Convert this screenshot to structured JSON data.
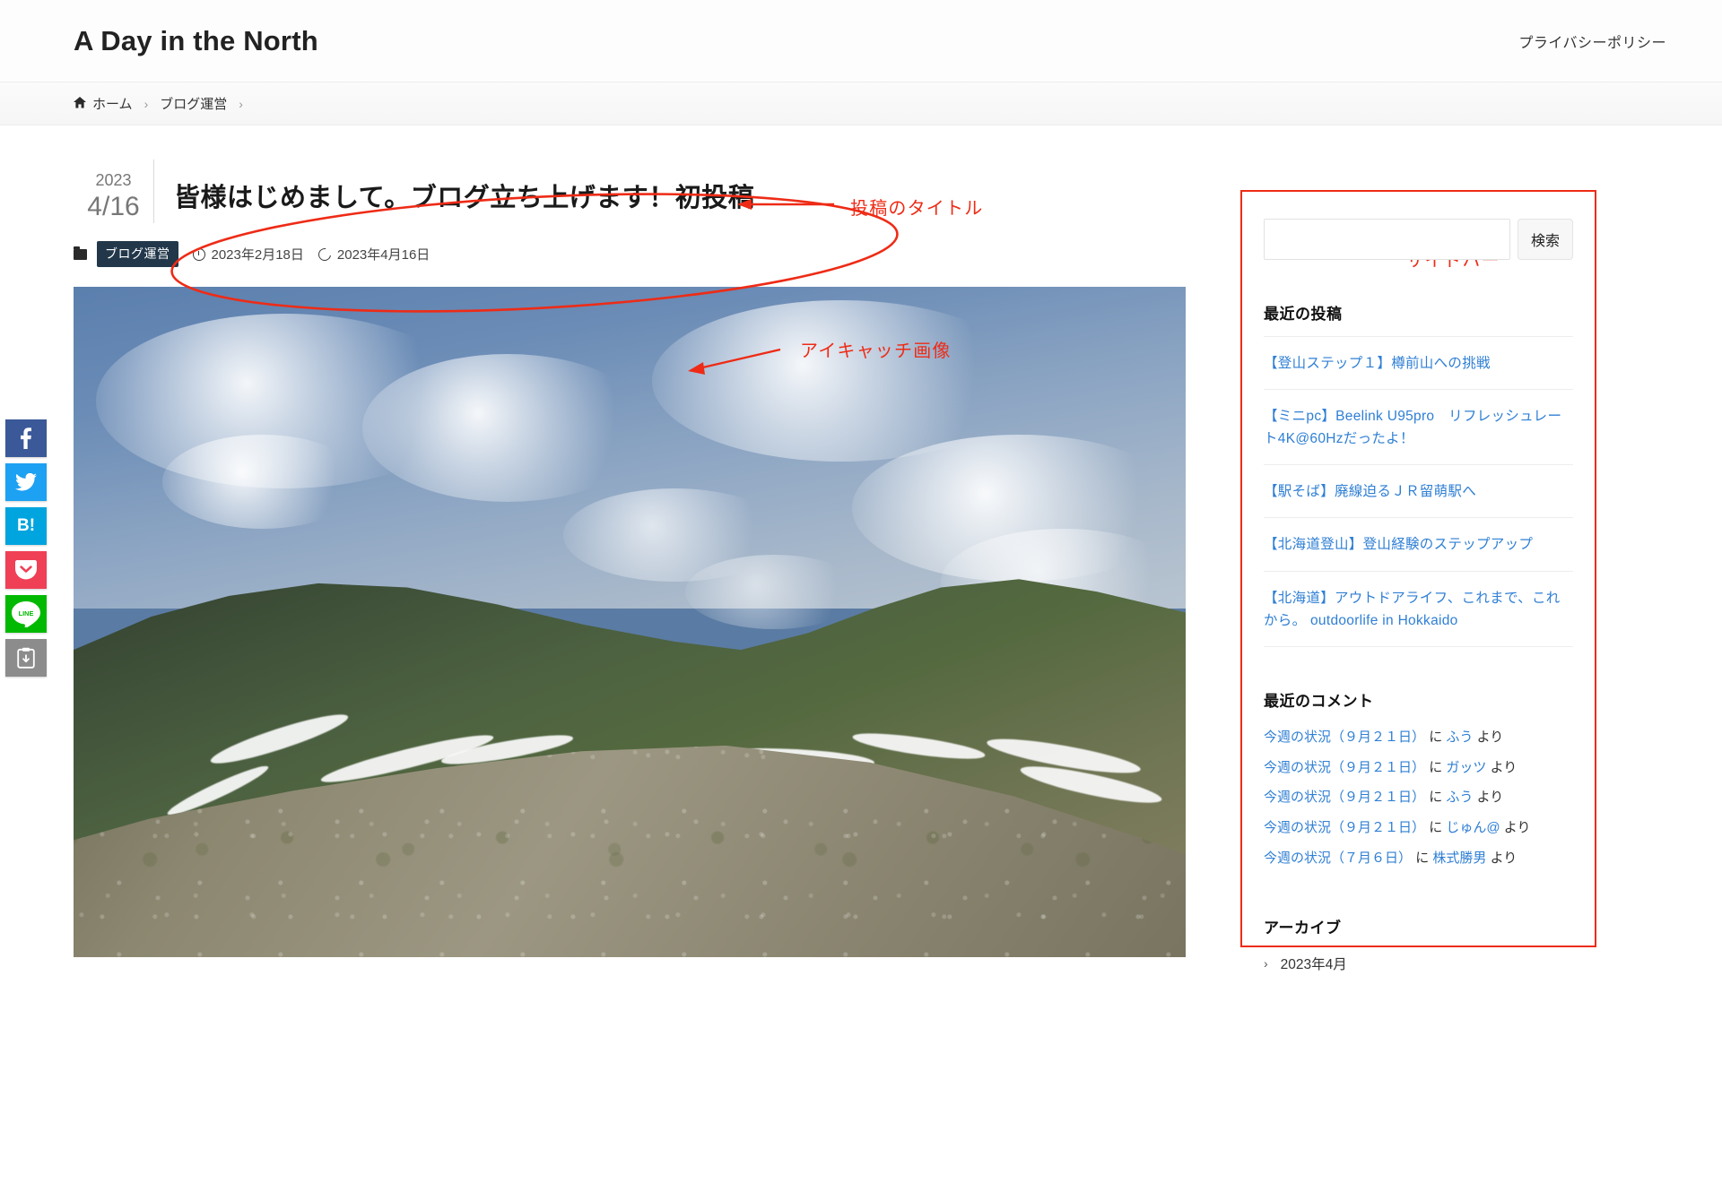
{
  "header": {
    "site_title": "A Day in the North",
    "nav": [
      {
        "label": "プライバシーポリシー",
        "name": "privacy-policy-link"
      }
    ]
  },
  "breadcrumb": {
    "home_icon": "home-icon",
    "items": [
      {
        "label": "ホーム"
      },
      {
        "label": "ブログ運営"
      }
    ],
    "separator": "›"
  },
  "post": {
    "date_year": "2023",
    "date_monthday": "4/16",
    "title": "皆様はじめまして。ブログ立ち上げます！初投稿",
    "category": "ブログ運営",
    "published_icon": "clock-icon",
    "published": "2023年2月18日",
    "updated_icon": "refresh-icon",
    "updated": "2023年4月16日",
    "eyecatch_alt": "雪渓の残る初夏の山岳風景"
  },
  "annotations": [
    {
      "id": "post-title-annotation",
      "label": "投稿のタイトル",
      "target": "post-title"
    },
    {
      "id": "eyecatch-annotation",
      "label": "アイキャッチ画像",
      "target": "eyecatch-image"
    },
    {
      "id": "sidebar-annotation",
      "label": "サイドバー",
      "target": "sidebar"
    }
  ],
  "annotation_color": "#ee2b16",
  "social_share": [
    {
      "name": "facebook-share-button",
      "glyph": "f",
      "color": "#3b5998"
    },
    {
      "name": "twitter-share-button",
      "glyph": "🐦",
      "color": "#1da1f2"
    },
    {
      "name": "hatena-bookmark-share-button",
      "glyph": "B!",
      "color": "#00a4de"
    },
    {
      "name": "pocket-share-button",
      "glyph": "▼",
      "color": "#ef4056"
    },
    {
      "name": "line-share-button",
      "glyph": "LINE",
      "color": "#00b900"
    },
    {
      "name": "copy-link-button",
      "glyph": "⎘",
      "color": "#8c8c8c"
    }
  ],
  "sidebar": {
    "search": {
      "value": "",
      "placeholder": "",
      "button_label": "検索"
    },
    "recent_posts": {
      "title": "最近の投稿",
      "items": [
        {
          "label": "【登山ステップ１】樽前山への挑戦"
        },
        {
          "label": "【ミニpc】Beelink U95pro　リフレッシュレート4K@60Hzだったよ！"
        },
        {
          "label": "【駅そば】廃線迫るＪＲ留萌駅へ"
        },
        {
          "label": "【北海道登山】登山経験のステップアップ"
        },
        {
          "label": "【北海道】アウトドアライフ、これまで、これから。 outdoorlife in Hokkaido"
        }
      ]
    },
    "recent_comments": {
      "title": "最近のコメント",
      "items": [
        {
          "post": "今週の状況（９月２１日）",
          "mid": "に",
          "author": "ふう",
          "suffix": "より"
        },
        {
          "post": "今週の状況（９月２１日）",
          "mid": "に",
          "author": "ガッツ",
          "suffix": "より"
        },
        {
          "post": "今週の状況（９月２１日）",
          "mid": "に",
          "author": "ふう",
          "suffix": "より"
        },
        {
          "post": "今週の状況（９月２１日）",
          "mid": "に",
          "author": "じゅん@",
          "suffix": "より"
        },
        {
          "post": "今週の状況（７月６日）",
          "mid": "に",
          "author": "株式勝男",
          "suffix": "より"
        }
      ]
    },
    "archives": {
      "title": "アーカイブ",
      "items": [
        {
          "label": "2023年4月",
          "chevron": "›"
        }
      ]
    }
  }
}
